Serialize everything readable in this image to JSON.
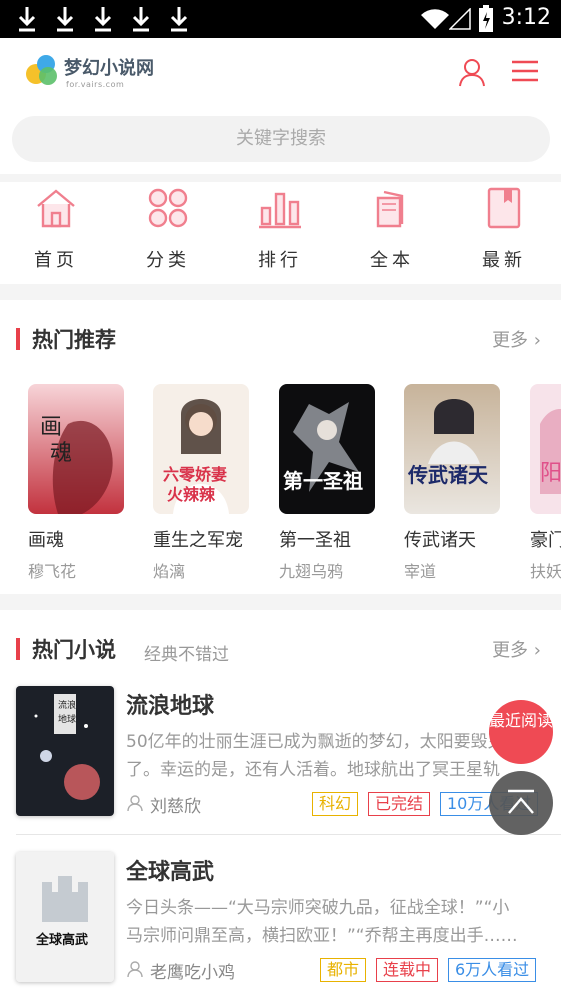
{
  "status": {
    "time": "3:12",
    "download_icons": 5
  },
  "header": {
    "title": "梦幻小说网",
    "subtitle": "for.vairs.com"
  },
  "search": {
    "placeholder": "关键字搜索"
  },
  "nav": [
    {
      "label": "首页",
      "icon": "home-icon"
    },
    {
      "label": "分类",
      "icon": "category-icon"
    },
    {
      "label": "排行",
      "icon": "ranking-icon"
    },
    {
      "label": "全本",
      "icon": "complete-books-icon"
    },
    {
      "label": "最新",
      "icon": "latest-icon"
    }
  ],
  "hot_recommend": {
    "title": "热门推荐",
    "more": "更多",
    "books": [
      {
        "name": "画魂",
        "author": "穆飞花"
      },
      {
        "name": "重生之军宠",
        "author": "焰漓"
      },
      {
        "name": "第一圣祖",
        "author": "九翅乌鸦"
      },
      {
        "name": "传武诸天",
        "author": "宰道"
      },
      {
        "name": "豪门",
        "author": "扶妖"
      }
    ]
  },
  "hot_novels": {
    "title": "热门小说",
    "subtitle": "经典不错过",
    "more": "更多",
    "items": [
      {
        "title": "流浪地球",
        "desc": "50亿年的壮丽生涯已成为飘逝的梦幻，太阳要毁灭了。幸运的是，还有人活着。地球航出了冥王星轨道……",
        "author": "刘慈欣",
        "tags": [
          "科幻",
          "已完结",
          "10万人看过"
        ]
      },
      {
        "title": "全球高武",
        "desc": "今日头条——“大马宗师突破九品，征战全球！”“小马宗师问鼎至高，横扫欧亚！”“乔帮主再度出手……",
        "author": "老鹰吃小鸡",
        "tags": [
          "都市",
          "连载中",
          "6万人看过"
        ]
      }
    ]
  },
  "floating": {
    "recent": "最近阅读"
  },
  "colors": {
    "accent": "#ef4a54",
    "nav_icon": "#f07f8e",
    "tag_genre": "#e8b200",
    "tag_status": "#e8404a",
    "tag_views": "#3a8ee6"
  }
}
